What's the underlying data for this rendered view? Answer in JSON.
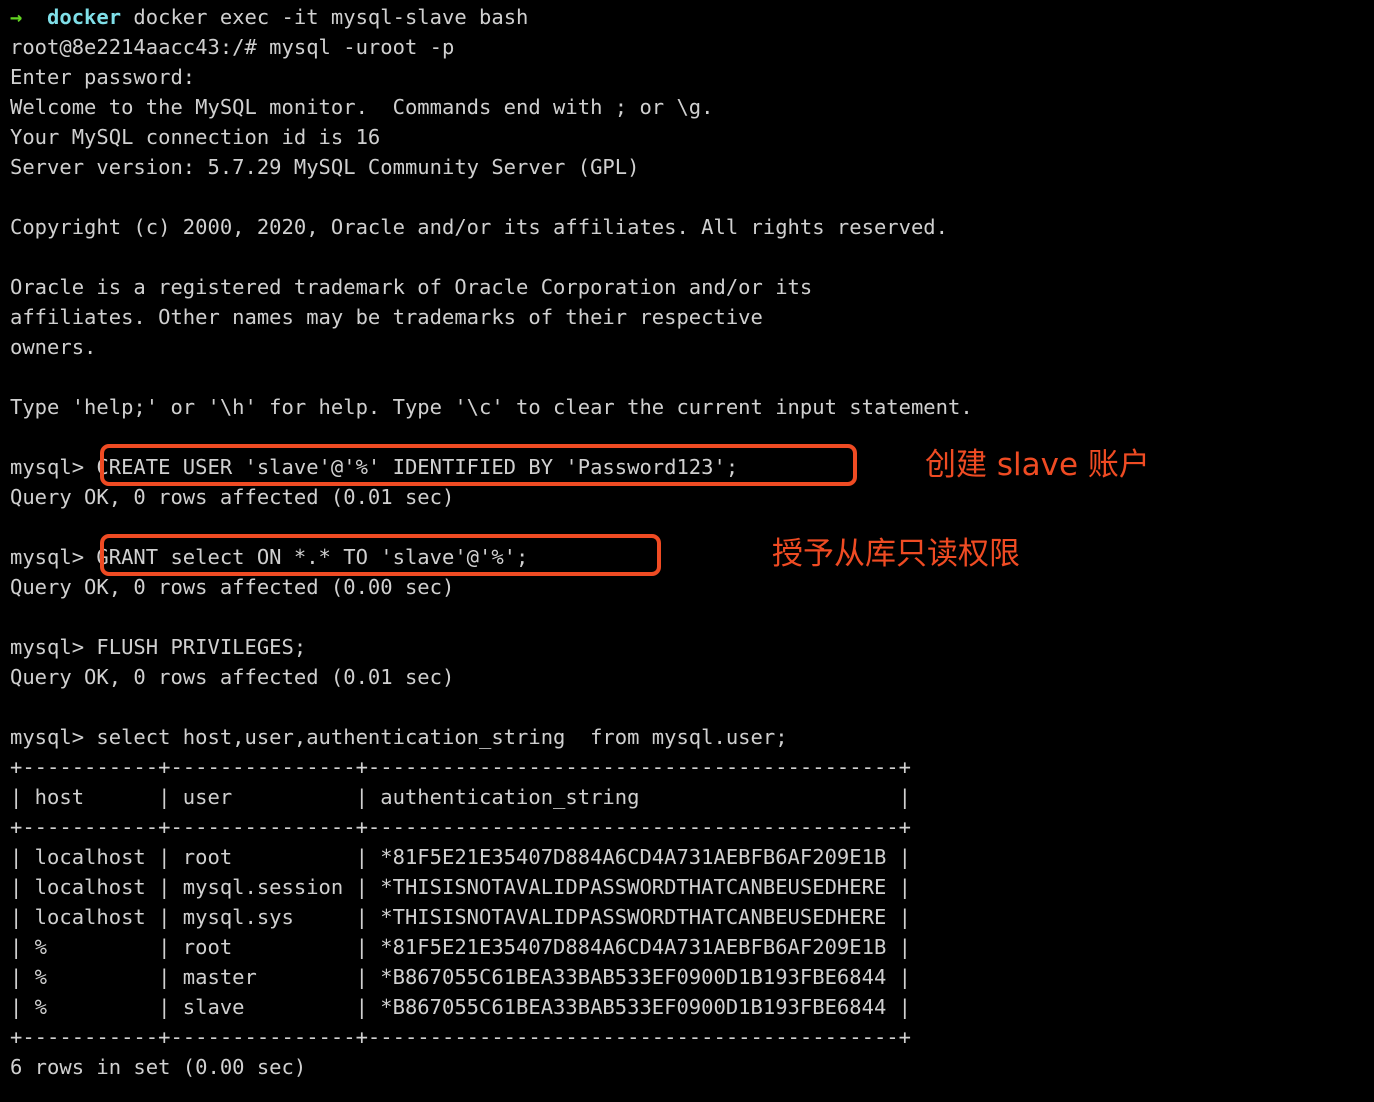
{
  "terminal": {
    "background_color": "#000000",
    "text_color": "#d0d0d0",
    "accent_color": "#ef4b23",
    "prompt_arrow_color": "#62d422",
    "prompt_context_color": "#7fdfe8",
    "prompt": {
      "arrow": "→",
      "context": "docker",
      "command": " docker exec -it mysql-slave bash"
    },
    "lines": [
      "root@8e2214aacc43:/# mysql -uroot -p",
      "Enter password:",
      "Welcome to the MySQL monitor.  Commands end with ; or \\g.",
      "Your MySQL connection id is 16",
      "Server version: 5.7.29 MySQL Community Server (GPL)",
      "",
      "Copyright (c) 2000, 2020, Oracle and/or its affiliates. All rights reserved.",
      "",
      "Oracle is a registered trademark of Oracle Corporation and/or its",
      "affiliates. Other names may be trademarks of their respective",
      "owners.",
      "",
      "Type 'help;' or '\\h' for help. Type '\\c' to clear the current input statement.",
      "",
      "mysql> CREATE USER 'slave'@'%' IDENTIFIED BY 'Password123';",
      "Query OK, 0 rows affected (0.01 sec)",
      "",
      "mysql> GRANT select ON *.* TO 'slave'@'%';",
      "Query OK, 0 rows affected (0.00 sec)",
      "",
      "mysql> FLUSH PRIVILEGES;",
      "Query OK, 0 rows affected (0.01 sec)",
      "",
      "mysql> select host,user,authentication_string  from mysql.user;",
      "+-----------+---------------+-------------------------------------------+",
      "| host      | user          | authentication_string                     |",
      "+-----------+---------------+-------------------------------------------+",
      "| localhost | root          | *81F5E21E35407D884A6CD4A731AEBFB6AF209E1B |",
      "| localhost | mysql.session | *THISISNOTAVALIDPASSWORDTHATCANBEUSEDHERE |",
      "| localhost | mysql.sys     | *THISISNOTAVALIDPASSWORDTHATCANBEUSEDHERE |",
      "| %         | root          | *81F5E21E35407D884A6CD4A731AEBFB6AF209E1B |",
      "| %         | master        | *B867055C61BEA33BAB533EF0900D1B193FBE6844 |",
      "| %         | slave         | *B867055C61BEA33BAB533EF0900D1B193FBE6844 |",
      "+-----------+---------------+-------------------------------------------+",
      "6 rows in set (0.00 sec)"
    ]
  },
  "query_result": {
    "type": "table",
    "columns": [
      "host",
      "user",
      "authentication_string"
    ],
    "rows": [
      [
        "localhost",
        "root",
        "*81F5E21E35407D884A6CD4A731AEBFB6AF209E1B"
      ],
      [
        "localhost",
        "mysql.session",
        "*THISISNOTAVALIDPASSWORDTHATCANBEUSEDHERE"
      ],
      [
        "localhost",
        "mysql.sys",
        "*THISISNOTAVALIDPASSWORDTHATCANBEUSEDHERE"
      ],
      [
        "%",
        "root",
        "*81F5E21E35407D884A6CD4A731AEBFB6AF209E1B"
      ],
      [
        "%",
        "master",
        "*B867055C61BEA33BAB533EF0900D1B193FBE6844"
      ],
      [
        "%",
        "slave",
        "*B867055C61BEA33BAB533EF0900D1B193FBE6844"
      ]
    ],
    "footer": "6 rows in set (0.00 sec)"
  },
  "annotations": [
    {
      "text": "创建 slave 账户",
      "color": "#ef4b23"
    },
    {
      "text": "授予从库只读权限",
      "color": "#ef4b23"
    }
  ],
  "highlights": [
    {
      "label": "CREATE USER 'slave'@'%' IDENTIFIED BY 'Password123';"
    },
    {
      "label": "GRANT select ON *.* TO 'slave'@'%';"
    }
  ]
}
